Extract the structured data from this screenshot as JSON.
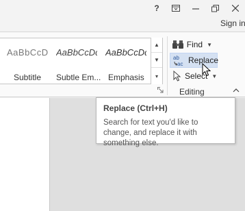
{
  "titlebar": {
    "help_label": "?",
    "ribbon_display_label": "⊡",
    "minimize_label": "—",
    "restore_label": "❐",
    "close_label": "✕"
  },
  "account": {
    "signin_label": "Sign in"
  },
  "styles": {
    "items": [
      {
        "sample": "AaBbCcD",
        "label": "Subtitle"
      },
      {
        "sample": "AaBbCcDd",
        "label": "Subtle Em..."
      },
      {
        "sample": "AaBbCcDd",
        "label": "Emphasis"
      }
    ],
    "scroll_up": "▲",
    "scroll_down": "▼",
    "more": "▾"
  },
  "editing": {
    "find_label": "Find",
    "replace_label": "Replace",
    "select_label": "Select",
    "group_label": "Editing",
    "caret": "▼",
    "collapse": "∧"
  },
  "tooltip": {
    "title": "Replace (Ctrl+H)",
    "body": "Search for text you'd like to change, and replace it with something else."
  },
  "icons": {
    "find": "binoculars-icon",
    "replace": "replace-icon",
    "select": "select-arrow-icon"
  }
}
